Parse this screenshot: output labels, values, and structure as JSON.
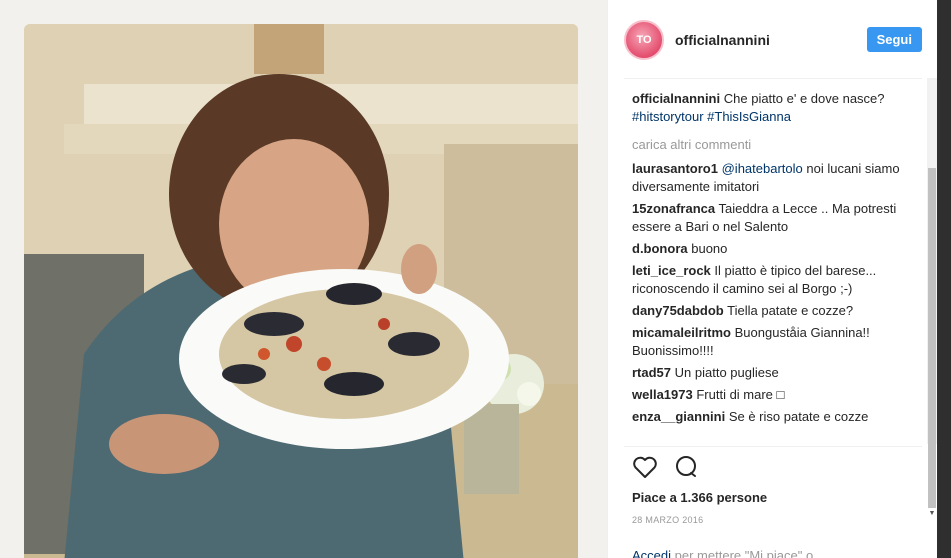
{
  "post": {
    "username": "officialnannini",
    "avatar_text": "TO",
    "follow_label": "Segui",
    "caption_user": "officialnannini",
    "caption_text": "Che piatto e' e dove nasce?",
    "caption_tags": "#hitstorytour #ThisIsGianna",
    "load_more": "carica altri commenti",
    "comments": [
      {
        "user": "laurasantoro1",
        "mention": "@ihatebartolo",
        "text": "noi lucani siamo diversamente imitatori"
      },
      {
        "user": "15zonafranca",
        "mention": "",
        "text": "Taieddra a Lecce .. Ma potresti essere a Bari o nel Salento"
      },
      {
        "user": "d.bonora",
        "mention": "",
        "text": "buono"
      },
      {
        "user": "leti_ice_rock",
        "mention": "",
        "text": "Il piatto è tipico del barese... riconoscendo il camino sei al Borgo ;-)"
      },
      {
        "user": "dany75dabdob",
        "mention": "",
        "text": "Tiella patate e cozze?"
      },
      {
        "user": "micamaleilritmo",
        "mention": "",
        "text": "Buonguståia Giannina!! Buonissimo!!!!"
      },
      {
        "user": "rtad57",
        "mention": "",
        "text": "Un piatto pugliese"
      },
      {
        "user": "wella1973",
        "mention": "",
        "text": "Frutti di mare □"
      },
      {
        "user": "enza__giannini",
        "mention": "",
        "text": "Se è riso patate e cozze"
      }
    ],
    "likes": "Piace a 1.366 persone",
    "date": "28 MARZO 2016",
    "login_link": "Accedi",
    "login_rest": "per mettere \"Mi piace\" o"
  },
  "icons": {
    "like": "heart-icon",
    "comment": "comment-icon"
  },
  "colors": {
    "accent": "#3897f0",
    "link": "#003569",
    "muted": "#999999"
  }
}
